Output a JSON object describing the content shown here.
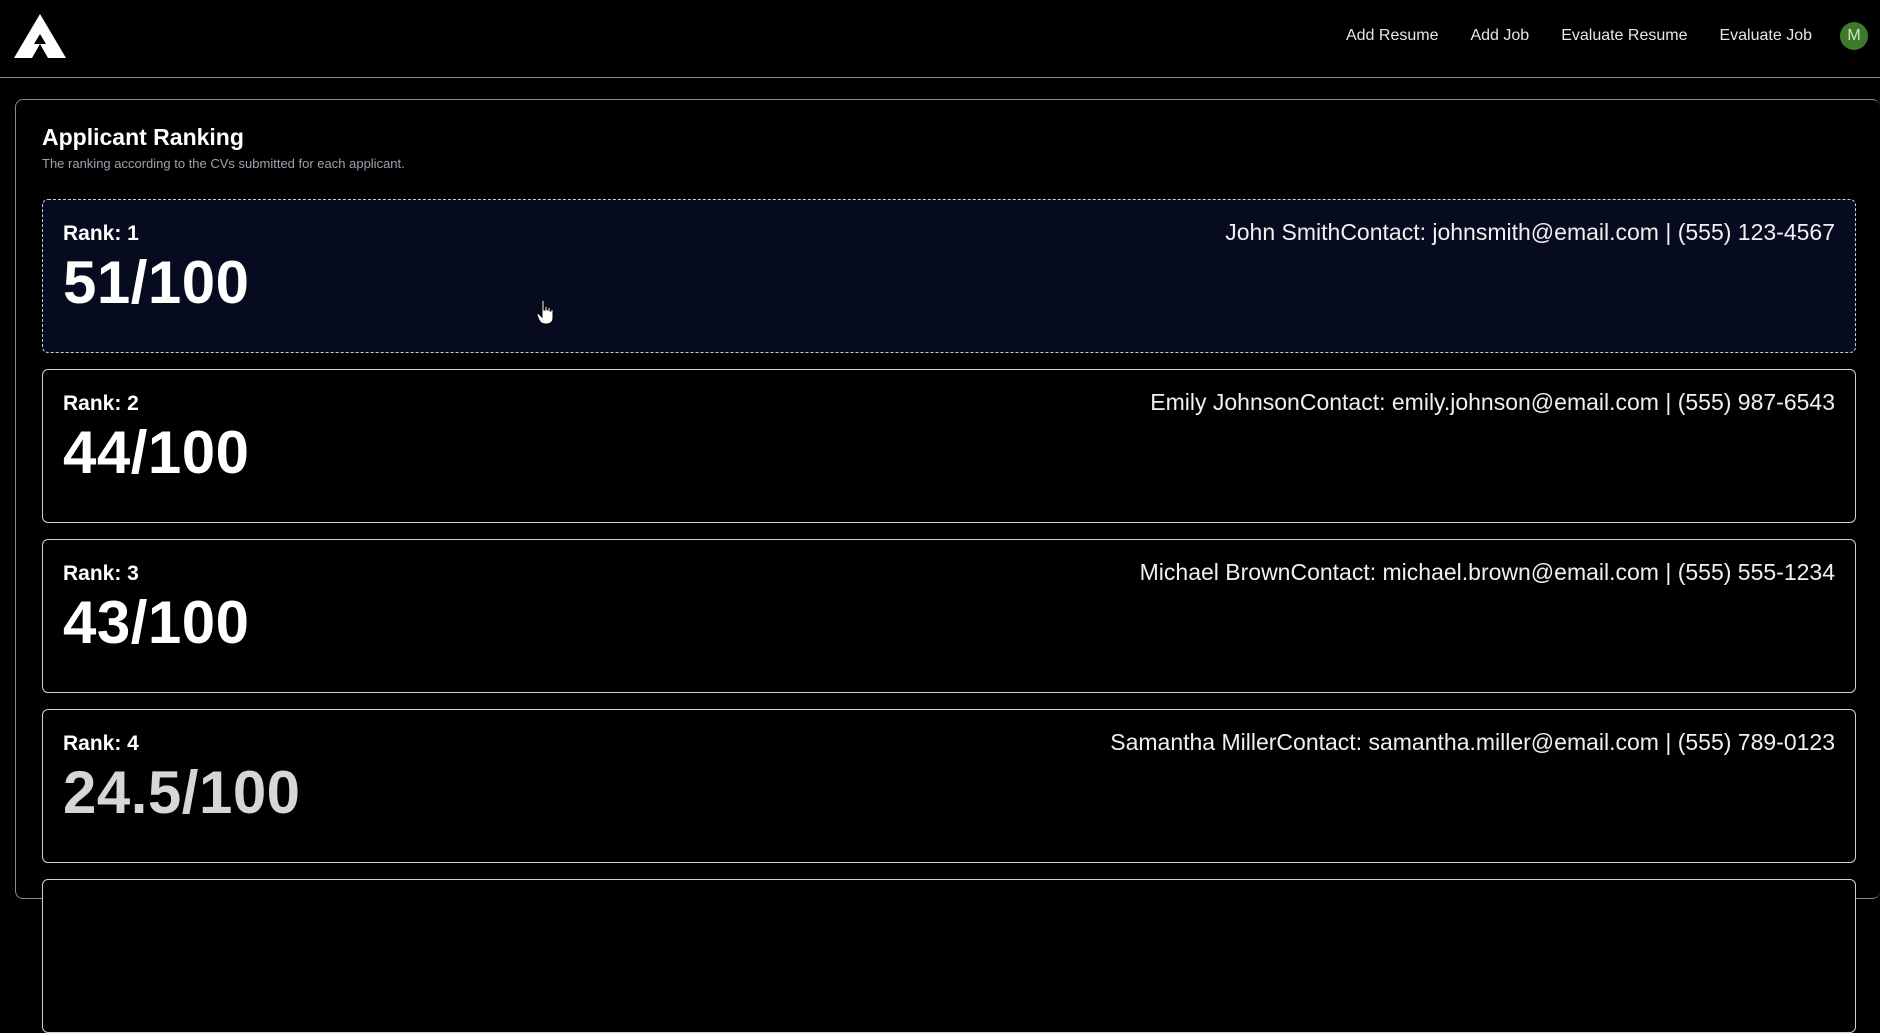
{
  "nav": {
    "items": [
      "Add Resume",
      "Add Job",
      "Evaluate Resume",
      "Evaluate Job"
    ],
    "avatar_initial": "M"
  },
  "panel": {
    "title": "Applicant Ranking",
    "subtitle": "The ranking according to the CVs submitted for each applicant."
  },
  "applicants": [
    {
      "rank_label": "Rank: 1",
      "score": "51/100",
      "contact": "John SmithContact: johnsmith@email.com | (555) 123-4567"
    },
    {
      "rank_label": "Rank: 2",
      "score": "44/100",
      "contact": "Emily JohnsonContact: emily.johnson@email.com | (555) 987-6543"
    },
    {
      "rank_label": "Rank: 3",
      "score": "43/100",
      "contact": "Michael BrownContact: michael.brown@email.com | (555) 555-1234"
    },
    {
      "rank_label": "Rank: 4",
      "score": "24.5/100",
      "contact": "Samantha MillerContact: samantha.miller@email.com | (555) 789-0123"
    }
  ]
}
